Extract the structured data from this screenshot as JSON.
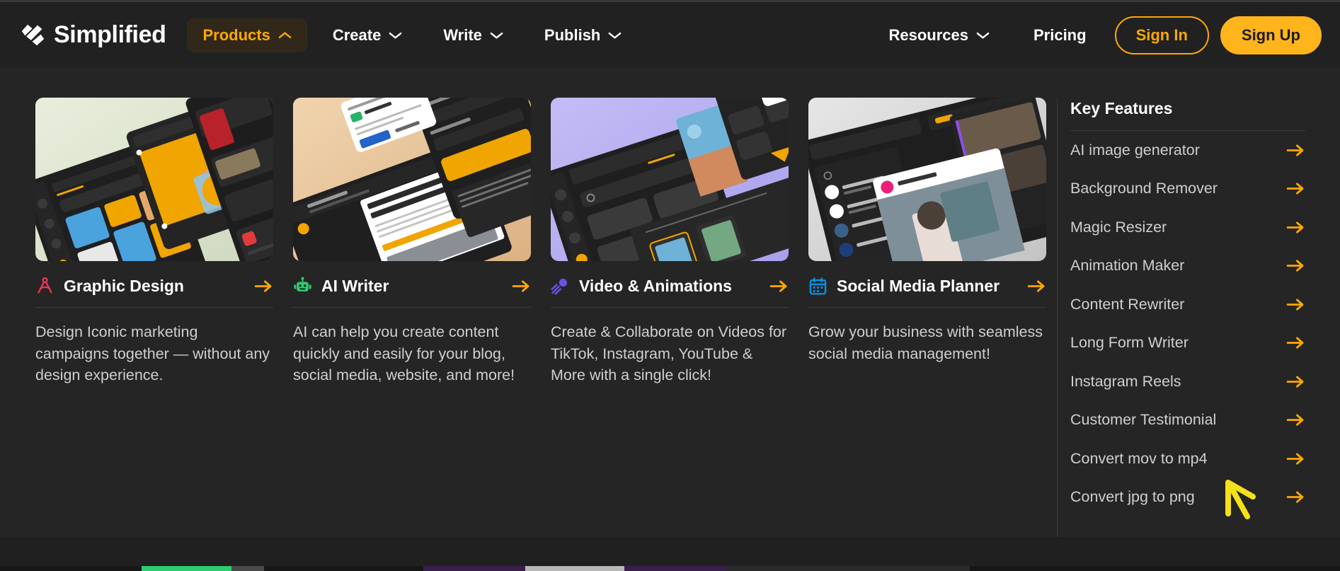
{
  "brand": {
    "name": "Simplified",
    "logo_icon": "simplified-logo-icon"
  },
  "nav": {
    "left_items": [
      {
        "label": "Products",
        "caret": "chevron-up-icon",
        "active": true
      },
      {
        "label": "Create",
        "caret": "chevron-down-icon",
        "active": false
      },
      {
        "label": "Write",
        "caret": "chevron-down-icon",
        "active": false
      },
      {
        "label": "Publish",
        "caret": "chevron-down-icon",
        "active": false
      }
    ],
    "right_items": [
      {
        "label": "Resources",
        "caret": "chevron-down-icon"
      },
      {
        "label": "Pricing",
        "caret": ""
      }
    ],
    "sign_in": "Sign In",
    "sign_up": "Sign Up"
  },
  "colors": {
    "accent": "#ffa800",
    "accent_solid": "#ffb41c",
    "header_bg": "#212121",
    "panel_bg": "#252525",
    "divider": "#3c3c3c",
    "body_text": "#cfcfcf",
    "cursor": "#f5e11a"
  },
  "mega_menu": {
    "cards": [
      {
        "title": "Graphic Design",
        "icon": "compass-drafting-icon",
        "icon_color": "#e63950",
        "arrow_icon": "arrow-right-icon",
        "description": "Design Iconic marketing campaigns together — without any design experience.",
        "thumb_bg": "#e4ebd7",
        "thumb_name": "graphic-design-preview"
      },
      {
        "title": "AI Writer",
        "icon": "robot-icon",
        "icon_color": "#2ecc71",
        "arrow_icon": "arrow-right-icon",
        "description": "AI can help you create content quickly and easily for your blog, social media, website, and more!",
        "thumb_bg": "#eccba4",
        "thumb_name": "ai-writer-preview"
      },
      {
        "title": "Video & Animations",
        "icon": "comet-icon",
        "icon_color": "#6c4ee8",
        "arrow_icon": "arrow-right-icon",
        "description": "Create & Collaborate on Videos for TikTok, Instagram, YouTube & More with a single click!",
        "thumb_bg": "#b9b2f0",
        "thumb_name": "video-animations-preview"
      },
      {
        "title": "Social Media Planner",
        "icon": "calendar-icon",
        "icon_color": "#0a90e0",
        "arrow_icon": "arrow-right-icon",
        "description": "Grow your business with seamless social media management!",
        "thumb_bg": "#d9d9d9",
        "thumb_name": "social-media-planner-preview"
      }
    ],
    "key_features": {
      "title": "Key Features",
      "items": [
        {
          "label": "AI image generator",
          "arrow_icon": "arrow-right-icon"
        },
        {
          "label": "Background Remover",
          "arrow_icon": "arrow-right-icon"
        },
        {
          "label": "Magic Resizer",
          "arrow_icon": "arrow-right-icon"
        },
        {
          "label": "Animation Maker",
          "arrow_icon": "arrow-right-icon"
        },
        {
          "label": "Content Rewriter",
          "arrow_icon": "arrow-right-icon"
        },
        {
          "label": "Long Form Writer",
          "arrow_icon": "arrow-right-icon"
        },
        {
          "label": "Instagram Reels",
          "arrow_icon": "arrow-right-icon"
        },
        {
          "label": "Customer Testimonial",
          "arrow_icon": "arrow-right-icon"
        },
        {
          "label": "Convert mov to mp4",
          "arrow_icon": "arrow-right-icon"
        },
        {
          "label": "Convert jpg to png",
          "arrow_icon": "arrow-right-icon"
        }
      ]
    }
  },
  "cursor": {
    "icon": "mouse-pointer-arrow-icon"
  }
}
